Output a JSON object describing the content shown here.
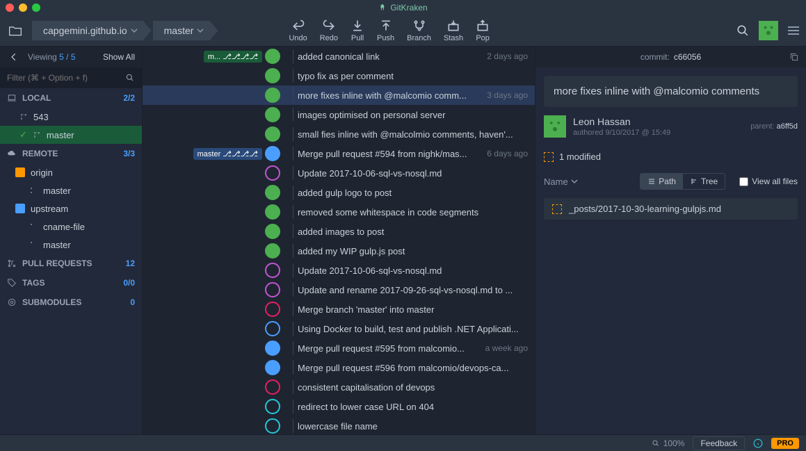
{
  "app": {
    "title": "GitKraken"
  },
  "toolbar": {
    "repo": "capgemini.github.io",
    "branch": "master",
    "actions": {
      "undo": "Undo",
      "redo": "Redo",
      "pull": "Pull",
      "push": "Push",
      "branch": "Branch",
      "stash": "Stash",
      "pop": "Pop"
    }
  },
  "sidebar": {
    "viewing_label": "Viewing",
    "viewing_count": "5 / 5",
    "show_all": "Show All",
    "filter_placeholder": "Filter (⌘ + Option + f)",
    "sections": {
      "local": {
        "label": "LOCAL",
        "count": "2/2"
      },
      "remote": {
        "label": "REMOTE",
        "count": "3/3"
      },
      "pull_requests": {
        "label": "PULL REQUESTS",
        "count": "12"
      },
      "tags": {
        "label": "TAGS",
        "count": "0/0"
      },
      "submodules": {
        "label": "SUBMODULES",
        "count": "0"
      }
    },
    "local_items": [
      "543",
      "master"
    ],
    "remotes": [
      {
        "name": "origin",
        "branches": [
          "master"
        ]
      },
      {
        "name": "upstream",
        "branches": [
          "cname-file",
          "master"
        ]
      }
    ]
  },
  "commits": [
    {
      "msg": "added canonical link",
      "time": "2 days ago",
      "label": "m...",
      "labelType": "green",
      "node": "green-fill"
    },
    {
      "msg": "typo fix as per comment",
      "time": "",
      "node": "green-fill"
    },
    {
      "msg": "more fixes inline with @malcomio comm...",
      "time": "3 days ago",
      "node": "green-fill",
      "selected": true
    },
    {
      "msg": "images optimised on personal server",
      "time": "",
      "node": "green-fill"
    },
    {
      "msg": "small fies inline with @malcolmio comments, haven'...",
      "time": "",
      "node": "green-fill"
    },
    {
      "msg": "Merge pull request #594 from nighk/mas...",
      "time": "6 days ago",
      "label": "master",
      "labelType": "blue",
      "node": "blue"
    },
    {
      "msg": "Update 2017-10-06-sql-vs-nosql.md",
      "time": "",
      "node": "purple"
    },
    {
      "msg": "added gulp logo to post",
      "time": "",
      "node": "green-fill"
    },
    {
      "msg": "removed some whitespace in code segments",
      "time": "",
      "node": "green-fill"
    },
    {
      "msg": "added images to post",
      "time": "",
      "node": "green-fill"
    },
    {
      "msg": "added my WIP gulp.js post",
      "time": "",
      "node": "green-fill"
    },
    {
      "msg": "Update 2017-10-06-sql-vs-nosql.md",
      "time": "",
      "node": "purple"
    },
    {
      "msg": "Update and rename 2017-09-26-sql-vs-nosql.md to ...",
      "time": "",
      "node": "purple"
    },
    {
      "msg": "Merge branch 'master' into master",
      "time": "",
      "node": "pink"
    },
    {
      "msg": "Using Docker to build, test and publish .NET Applicati...",
      "time": "",
      "node": "blue-ring"
    },
    {
      "msg": "Merge pull request #595 from malcomio...",
      "time": "a week ago",
      "node": "blue"
    },
    {
      "msg": "Merge pull request #596 from malcomio/devops-ca...",
      "time": "",
      "node": "blue"
    },
    {
      "msg": "consistent capitalisation of devops",
      "time": "",
      "node": "pink"
    },
    {
      "msg": "redirect to lower case URL on 404",
      "time": "",
      "node": "teal"
    },
    {
      "msg": "lowercase file name",
      "time": "",
      "node": "teal"
    }
  ],
  "details": {
    "commit_label": "commit:",
    "commit_hash": "c66056",
    "message": "more fixes inline with @malcomio comments",
    "author_name": "Leon Hassan",
    "authored_label": "authored",
    "author_date": "9/10/2017 @ 15:49",
    "parent_label": "parent:",
    "parent_hash": "a6ff5d",
    "modified_count": "1 modified",
    "sort_label": "Name",
    "path_btn": "Path",
    "tree_btn": "Tree",
    "view_all_label": "View all files",
    "files": [
      "_posts/2017-10-30-learning-gulpjs.md"
    ]
  },
  "statusbar": {
    "zoom": "100%",
    "feedback": "Feedback",
    "pro": "PRO"
  }
}
